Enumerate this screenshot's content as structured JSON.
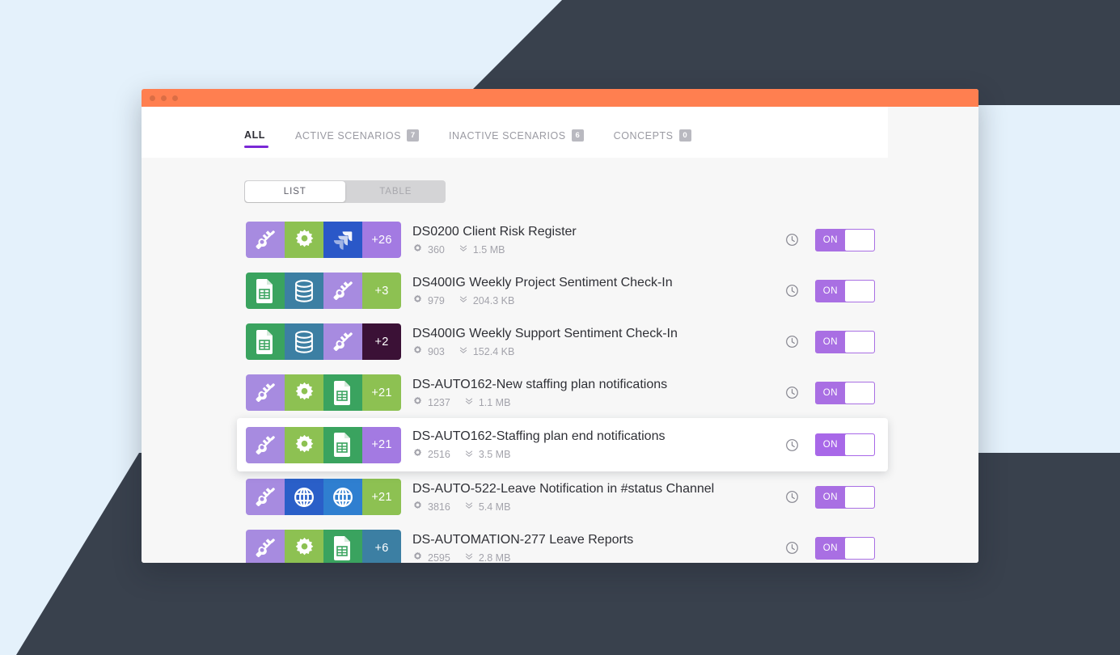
{
  "window": {
    "titlebar_dots": 3,
    "accent_orange": "#ff7f50",
    "accent_purple": "#7a28d6"
  },
  "tabs": [
    {
      "label": "ALL",
      "badge": null,
      "active": true
    },
    {
      "label": "ACTIVE SCENARIOS",
      "badge": "7",
      "active": false
    },
    {
      "label": "INACTIVE SCENARIOS",
      "badge": "6",
      "active": false
    },
    {
      "label": "CONCEPTS",
      "badge": "0",
      "active": false
    }
  ],
  "view_switch": {
    "list_label": "LIST",
    "table_label": "TABLE",
    "active": "LIST"
  },
  "rows": [
    {
      "title": "DS0200 Client Risk Register",
      "ops": "360",
      "size": "1.5 MB",
      "toggle": "ON",
      "selected": false,
      "icons": [
        {
          "name": "tools-icon",
          "bg": "#a78be0"
        },
        {
          "name": "gear-icon",
          "bg": "#8dc152"
        },
        {
          "name": "jira-icon",
          "bg": "#2a58c8"
        },
        {
          "name": "more-count",
          "bg": "#a37ae2",
          "label": "+26"
        }
      ]
    },
    {
      "title": "DS400IG Weekly Project Sentiment Check-In",
      "ops": "979",
      "size": "204.3 KB",
      "toggle": "ON",
      "selected": false,
      "icons": [
        {
          "name": "google-sheets-icon",
          "bg": "#3aa35f"
        },
        {
          "name": "database-icon",
          "bg": "#3c7fa3"
        },
        {
          "name": "tools-icon",
          "bg": "#a78be0"
        },
        {
          "name": "more-count",
          "bg": "#8dc152",
          "label": "+3"
        }
      ]
    },
    {
      "title": "DS400IG Weekly Support Sentiment Check-In",
      "ops": "903",
      "size": "152.4 KB",
      "toggle": "ON",
      "selected": false,
      "icons": [
        {
          "name": "google-sheets-icon",
          "bg": "#3aa35f"
        },
        {
          "name": "database-icon",
          "bg": "#3c7fa3"
        },
        {
          "name": "tools-icon",
          "bg": "#a78be0"
        },
        {
          "name": "more-count",
          "bg": "#3b1136",
          "label": "+2"
        }
      ]
    },
    {
      "title": "DS-AUTO162-New staffing plan notifications",
      "ops": "1237",
      "size": "1.1 MB",
      "toggle": "ON",
      "selected": false,
      "icons": [
        {
          "name": "tools-icon",
          "bg": "#a78be0"
        },
        {
          "name": "gear-icon",
          "bg": "#8dc152"
        },
        {
          "name": "google-sheets-icon",
          "bg": "#3aa35f"
        },
        {
          "name": "more-count",
          "bg": "#8dc152",
          "label": "+21"
        }
      ]
    },
    {
      "title": "DS-AUTO162-Staffing plan end notifications",
      "ops": "2516",
      "size": "3.5 MB",
      "toggle": "ON",
      "selected": true,
      "icons": [
        {
          "name": "tools-icon",
          "bg": "#a78be0"
        },
        {
          "name": "gear-icon",
          "bg": "#8dc152"
        },
        {
          "name": "google-sheets-icon",
          "bg": "#3aa35f"
        },
        {
          "name": "more-count",
          "bg": "#a37ae2",
          "label": "+21"
        }
      ]
    },
    {
      "title": "DS-AUTO-522-Leave Notification in #status Channel",
      "ops": "3816",
      "size": "5.4 MB",
      "toggle": "ON",
      "selected": false,
      "icons": [
        {
          "name": "tools-icon",
          "bg": "#a78be0"
        },
        {
          "name": "globe-icon",
          "bg": "#2a5fc8"
        },
        {
          "name": "globe-icon",
          "bg": "#2f7fd0"
        },
        {
          "name": "more-count",
          "bg": "#8dc152",
          "label": "+21"
        }
      ]
    },
    {
      "title": "DS-AUTOMATION-277 Leave Reports",
      "ops": "2595",
      "size": "2.8 MB",
      "toggle": "ON",
      "selected": false,
      "icons": [
        {
          "name": "tools-icon",
          "bg": "#a78be0"
        },
        {
          "name": "gear-icon",
          "bg": "#8dc152"
        },
        {
          "name": "google-sheets-icon",
          "bg": "#3aa35f"
        },
        {
          "name": "more-count",
          "bg": "#3c7fa3",
          "label": "+6"
        }
      ]
    }
  ]
}
